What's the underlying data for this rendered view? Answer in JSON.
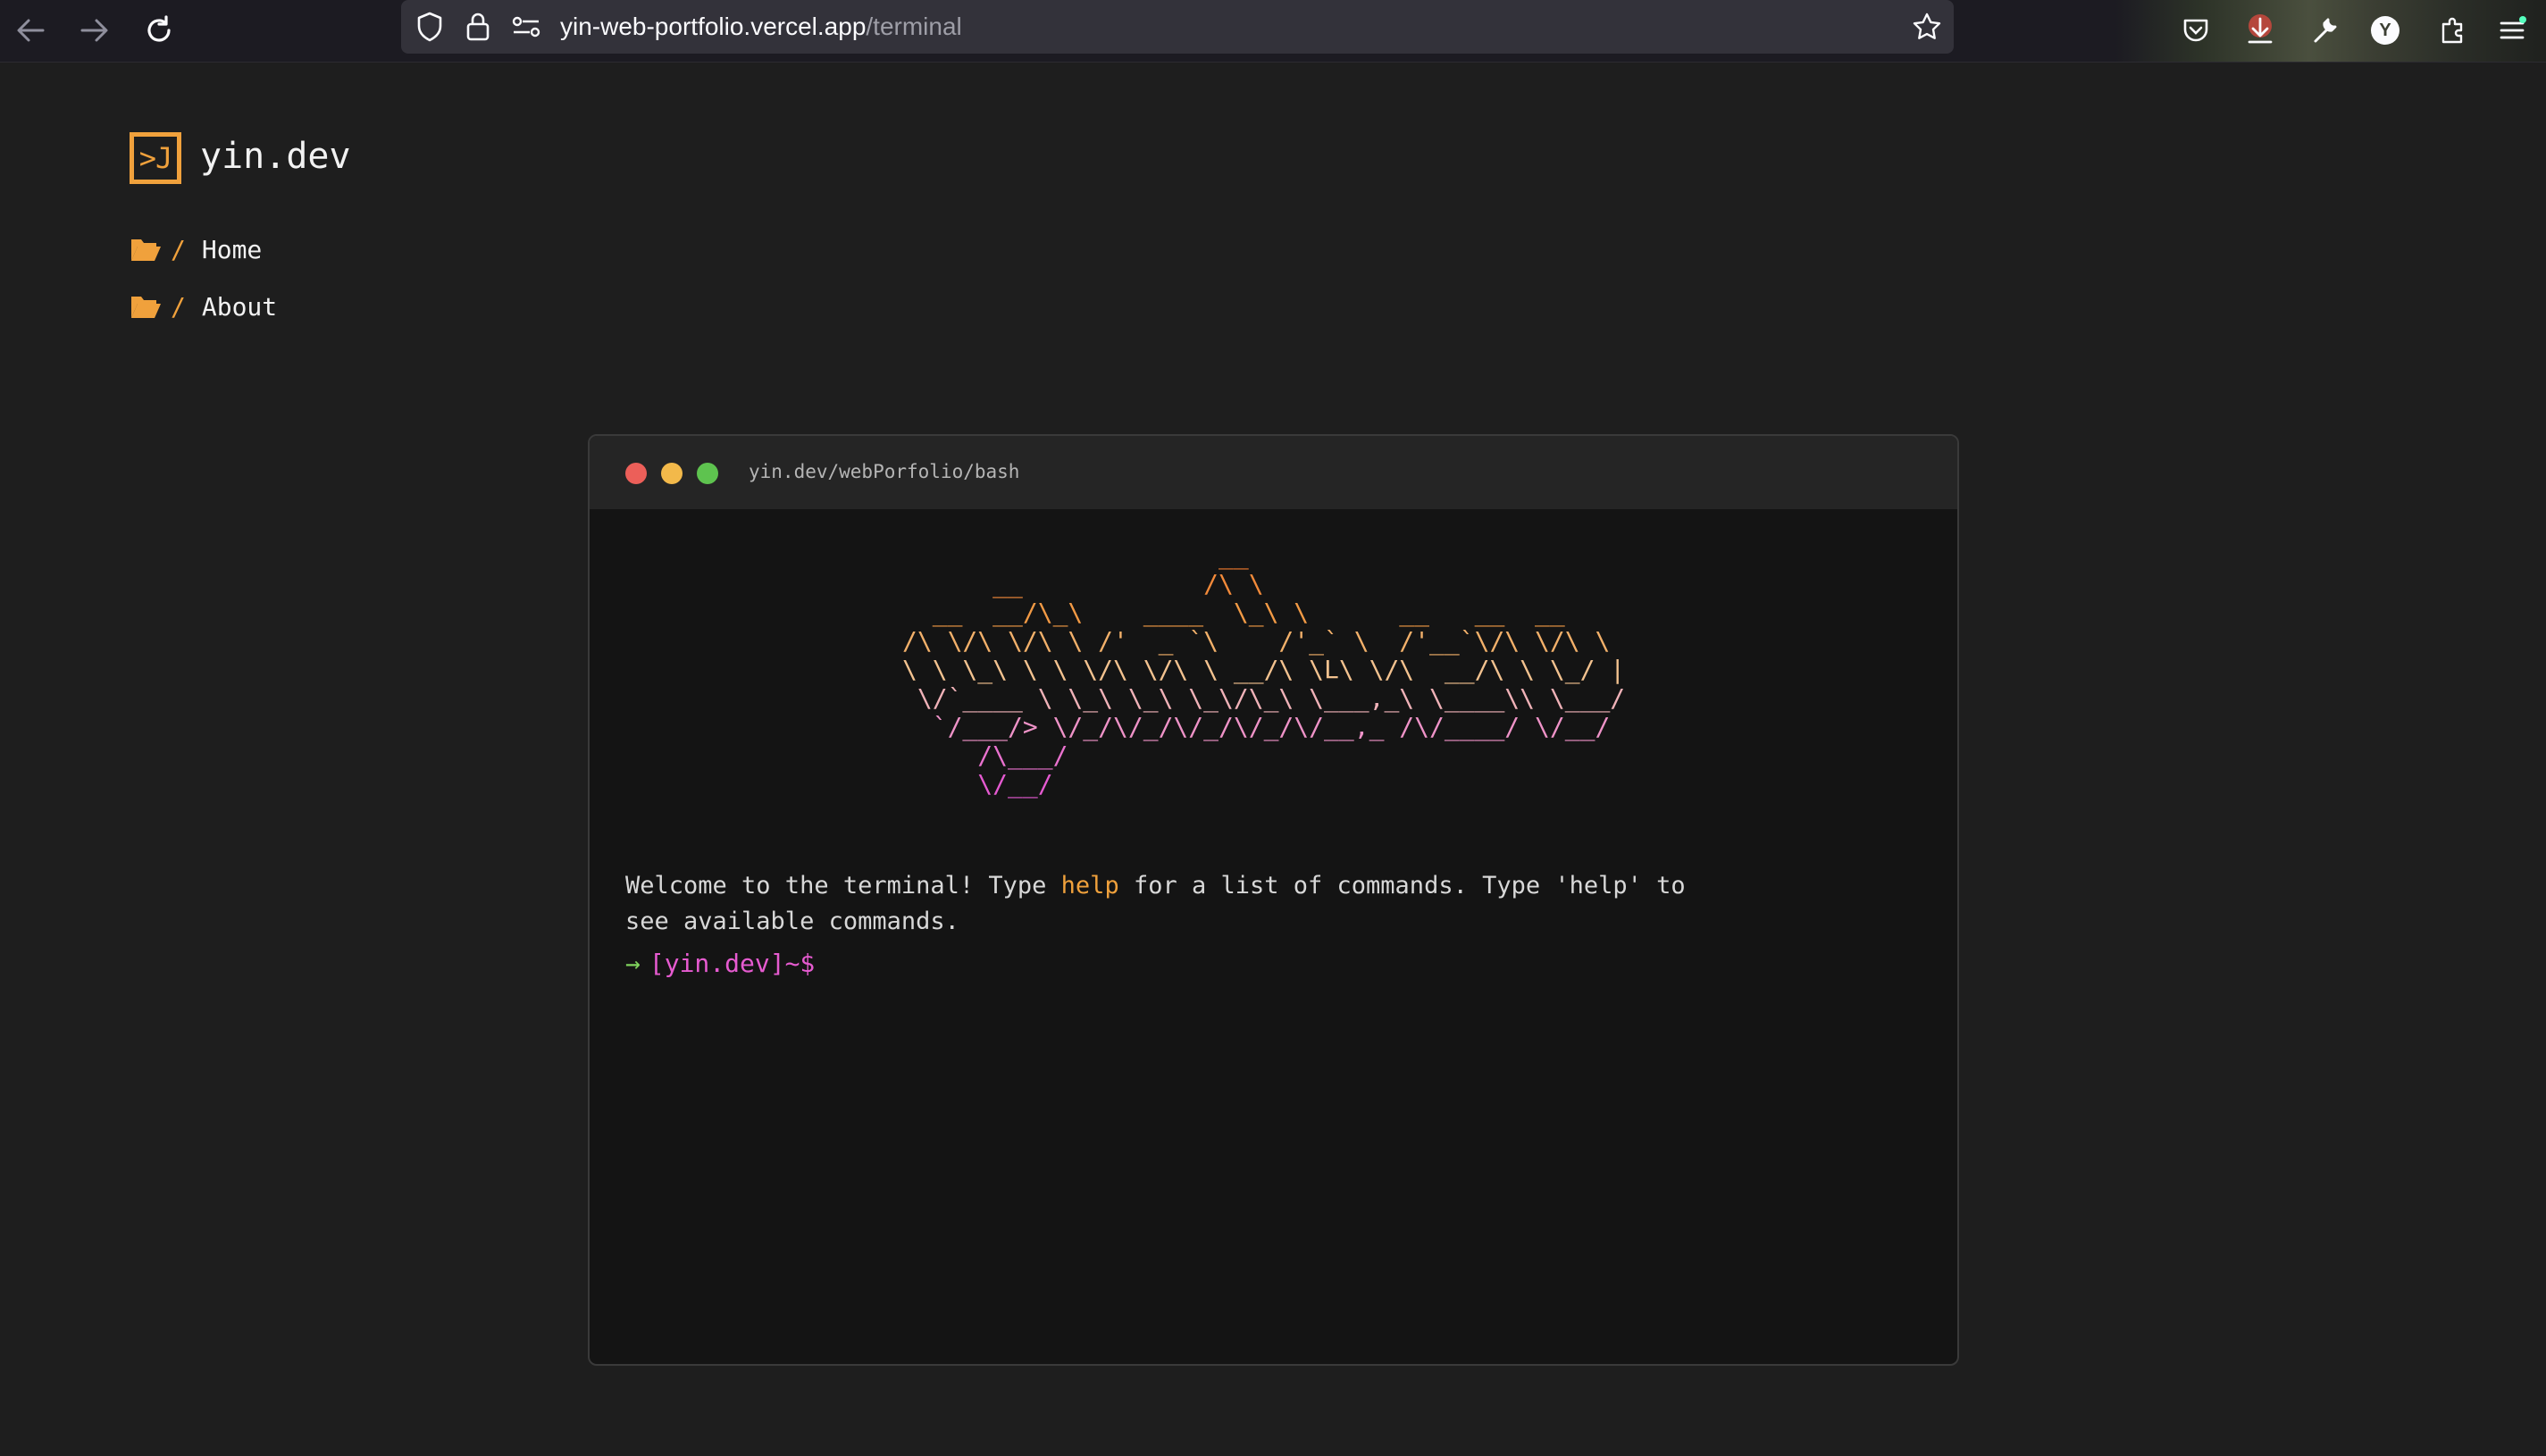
{
  "browser": {
    "url_host": "yin-web-portfolio.vercel.app",
    "url_path": "/terminal",
    "profile_initial": "Y",
    "icons": [
      "back-icon",
      "forward-icon",
      "reload-icon",
      "shield-icon",
      "lock-icon",
      "permissions-icon",
      "bookmark-star-icon",
      "pocket-icon",
      "download-icon",
      "wrench-icon",
      "account-icon",
      "extensions-icon",
      "menu-icon"
    ]
  },
  "site": {
    "logo_mark": ">J",
    "logo_text": "yin.dev",
    "nav": [
      {
        "slash": "/",
        "label": "Home"
      },
      {
        "slash": "/",
        "label": "About"
      }
    ],
    "accent": "#f0a13c"
  },
  "terminal": {
    "title": "yin.dev/webPorfolio/bash",
    "ascii_art": [
      "                     __",
      "      __            /\\ \\",
      "  __  __/\\_\\    ____  \\_\\ \\      __   __  __",
      "/\\ \\/\\ \\/\\ \\ /'  _ `\\    /'_` \\  /'__`\\/\\ \\/\\ \\",
      "\\ \\ \\_\\ \\ \\ \\/\\ \\/\\ \\ __/\\ \\L\\ \\/\\  __/\\ \\ \\_/ |",
      " \\/`____ \\ \\_\\ \\_\\ \\_\\/\\_\\ \\___,_\\ \\____\\\\ \\___/",
      "  `/___/> \\/_/\\/_/\\/_/\\/_/\\/__,_ /\\/____/ \\/__/",
      "     /\\___/",
      "     \\/__/"
    ],
    "ascii_colors": [
      "#f07b2e",
      "#f28a3a",
      "#f29a45",
      "#f2b06a",
      "#f3c28f",
      "#f0b2b8",
      "#ef93c8",
      "#ea72cf",
      "#e55ad1"
    ],
    "welcome_pre": "Welcome to the terminal! Type ",
    "welcome_keyword": "help",
    "welcome_post": " for a list of commands. Type 'help' to",
    "welcome_line2": "see available commands.",
    "prompt_arrow": "→",
    "prompt": "[yin.dev]~$",
    "dot_colors": [
      "#ec5f59",
      "#f3b94a",
      "#5ec34f"
    ]
  }
}
